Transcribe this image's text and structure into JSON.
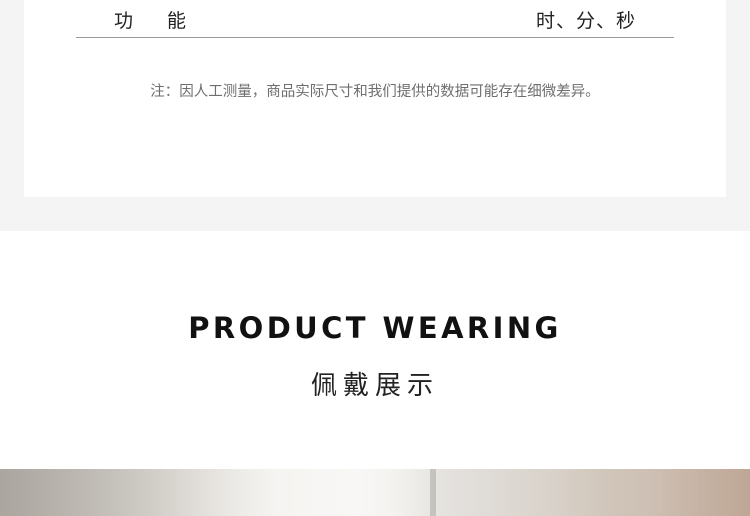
{
  "spec": {
    "label": "功能",
    "value": "时、分、秒",
    "note": "注：因人工测量，商品实际尺寸和我们提供的数据可能存在细微差异。"
  },
  "section": {
    "title": "PRODUCT WEARING",
    "subtitle": "佩戴展示"
  },
  "colors": {
    "band_background": "#f4f4f4",
    "card_background": "#ffffff",
    "divider": "#9a9a9a",
    "note_text": "#6e6e6e",
    "title_text": "#111111"
  }
}
